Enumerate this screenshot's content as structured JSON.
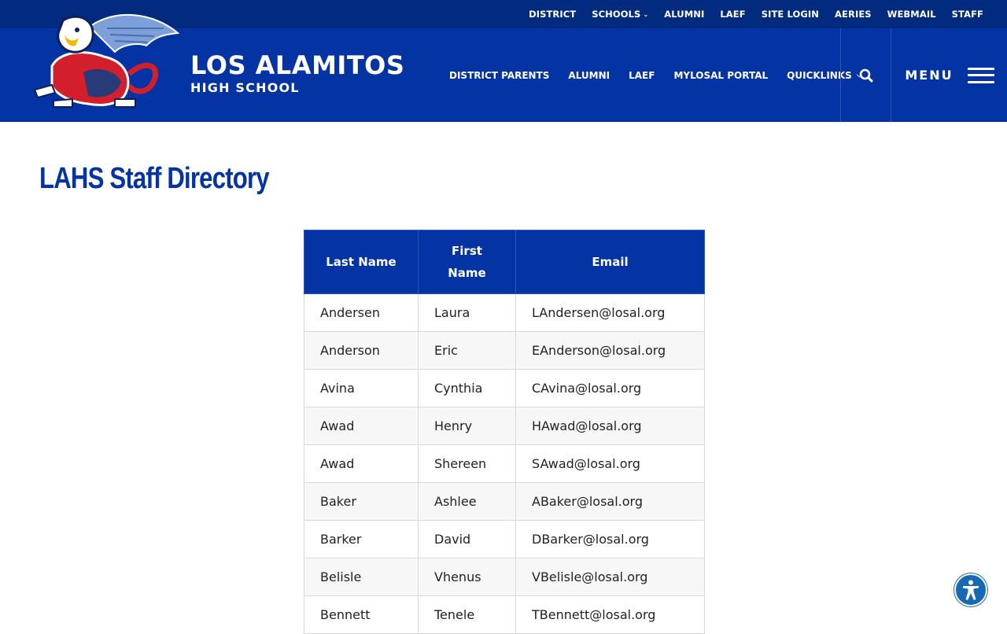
{
  "utility_nav": [
    {
      "label": "DISTRICT"
    },
    {
      "label": "SCHOOLS",
      "has_dropdown": true
    },
    {
      "label": "ALUMNI"
    },
    {
      "label": "LAEF"
    },
    {
      "label": "SITE LOGIN"
    },
    {
      "label": "AERIES"
    },
    {
      "label": "WEBMAIL"
    },
    {
      "label": "STAFF"
    }
  ],
  "header": {
    "school_name": "LOS ALAMITOS",
    "school_subtitle": "HIGH SCHOOL",
    "logo_icon": "griffin-mascot-logo",
    "search_icon": "search-icon",
    "menu_label": "MENU"
  },
  "main_nav": [
    {
      "label": "DISTRICT PARENTS"
    },
    {
      "label": "ALUMNI"
    },
    {
      "label": "LAEF"
    },
    {
      "label": "MYLOSAL PORTAL"
    },
    {
      "label": "QUICKLINKS",
      "has_dropdown": true
    }
  ],
  "page": {
    "title": "LAHS Staff Directory"
  },
  "directory": {
    "headers": [
      "Last Name",
      "First Name",
      "Email"
    ],
    "rows": [
      [
        "Andersen",
        "Laura",
        "LAndersen@losal.org"
      ],
      [
        "Anderson",
        "Eric",
        "EAnderson@losal.org"
      ],
      [
        "Avina",
        "Cynthia",
        "CAvina@losal.org"
      ],
      [
        "Awad",
        "Henry",
        "HAwad@losal.org"
      ],
      [
        "Awad",
        "Shereen",
        "SAwad@losal.org"
      ],
      [
        "Baker",
        "Ashlee",
        "ABaker@losal.org"
      ],
      [
        "Barker",
        "David",
        "DBarker@losal.org"
      ],
      [
        "Belisle",
        "Vhenus",
        "VBelisle@losal.org"
      ],
      [
        "Bennett",
        "Tenele",
        "TBennett@losal.org"
      ]
    ]
  },
  "colors": {
    "brand_blue": "#0433a3",
    "utility_blue": "#022b80",
    "accessibility_blue": "#1769b6"
  },
  "accessibility_icon": "accessibility-icon"
}
